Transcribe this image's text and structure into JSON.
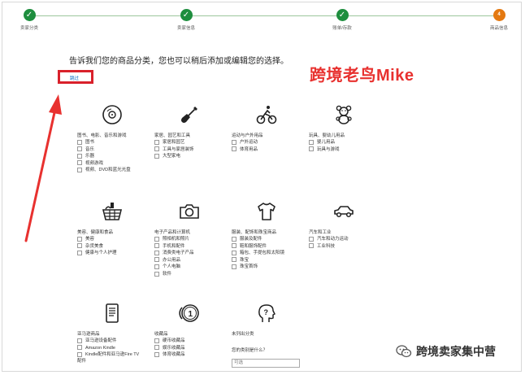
{
  "progress": {
    "steps": [
      {
        "label": "卖家分类",
        "state": "done",
        "mark": "✓"
      },
      {
        "label": "卖家信息",
        "state": "done",
        "mark": "✓"
      },
      {
        "label": "账单/存款",
        "state": "done",
        "mark": "✓"
      },
      {
        "label": "商品信息",
        "state": "current",
        "mark": "4"
      }
    ],
    "done_color": "#1e8e3e",
    "current_color": "#e47911"
  },
  "instruction": "告诉我们您的商品分类，您也可以稍后添加或编辑您的选择。",
  "watermark_title": "跨境老鸟Mike",
  "skip_link": "跳过",
  "categories": [
    {
      "name": "图书、电影、音乐和游戏",
      "icon": "disc-icon",
      "items": [
        "图书",
        "音乐",
        "乐器",
        "视频游戏",
        "视频、DVD和蓝光光盘"
      ]
    },
    {
      "name": "家居、园艺和工具",
      "icon": "shovel-icon",
      "items": [
        "家居和园艺",
        "工具与家居装饰",
        "大型家电"
      ]
    },
    {
      "name": "运动与户外用品",
      "icon": "cyclist-icon",
      "items": [
        "户外运动",
        "体育用品"
      ]
    },
    {
      "name": "玩具、婴幼儿用品",
      "icon": "teddy-bear-icon",
      "items": [
        "婴儿用品",
        "玩具与游戏"
      ]
    },
    {
      "name": "美容、健康和食品",
      "icon": "basket-icon",
      "items": [
        "美容",
        "杂货美食",
        "健康与个人护理"
      ]
    },
    {
      "name": "电子产品和计算机",
      "icon": "camera-icon",
      "items": [
        "照相机和照片",
        "手机和配件",
        "消费类电子产品",
        "办公用品",
        "个人电脑",
        "软件"
      ]
    },
    {
      "name": "服装、配饰和珠宝商品",
      "icon": "tshirt-icon",
      "items": [
        "服装及配件",
        "鞋和服饰配件",
        "箱包、手提包和太阳镜",
        "珠宝",
        "珠宝首饰"
      ]
    },
    {
      "name": "汽车和工业",
      "icon": "car-icon",
      "items": [
        "汽车和动力运动",
        "工业科技"
      ]
    },
    {
      "name": "亚马逊商品",
      "icon": "ereader-icon",
      "items": [
        "亚马逊设备配件",
        "Amazon Kindle",
        "Kindle配件和亚马逊Fire TV配件"
      ]
    },
    {
      "name": "收藏品",
      "icon": "coin-icon",
      "items": [
        "硬币收藏品",
        "娱乐收藏品",
        "体育收藏品"
      ]
    },
    {
      "name": "未列出分类",
      "icon": "question-head-icon",
      "items": [],
      "subquestion": "您的类别是什么？",
      "placeholder": "可选"
    }
  ],
  "wechat_label": "跨境卖家集中营",
  "accent": {
    "annotation_red": "#d9212b",
    "link_blue": "#0066c0"
  }
}
